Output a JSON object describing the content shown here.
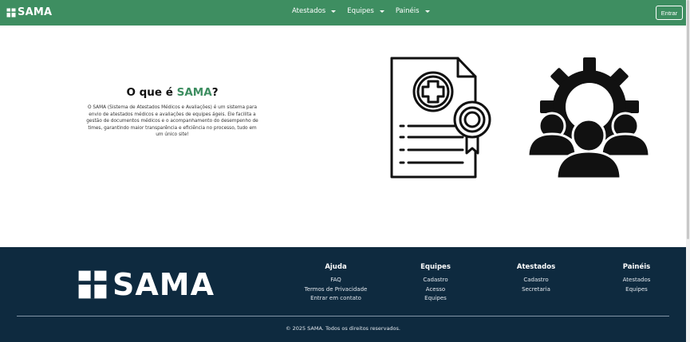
{
  "brand": {
    "name": "SAMA",
    "logo_icon": "medical-cross-logo-icon"
  },
  "nav": {
    "items": [
      {
        "label": "Atestados"
      },
      {
        "label": "Equipes"
      },
      {
        "label": "Painéis"
      }
    ],
    "login_label": "Entrar"
  },
  "about": {
    "title_prefix": "O que é ",
    "title_accent": "SAMA",
    "title_suffix": "?",
    "description": "O SAMA (Sistema de Atestados Médicos e Avaliações) é um sistema para envio de atestados médicos e avaliações de equipes ágeis. Ele facilita a gestão de documentos médicos e o acompanhamento do desempenho de times, garantindo maior transparência e eficiência no processo, tudo em um único site!"
  },
  "illustrations": {
    "certificate": "medical-certificate-icon",
    "team": "team-gear-icon"
  },
  "footer": {
    "logo_text": "SAMA",
    "columns": [
      {
        "title": "Ajuda",
        "links": [
          "FAQ",
          "Termos de Privacidade",
          "Entrar em contato"
        ]
      },
      {
        "title": "Equipes",
        "links": [
          "Cadastro",
          "Acesso",
          "Equipes"
        ]
      },
      {
        "title": "Atestados",
        "links": [
          "Cadastro",
          "Secretaria"
        ]
      },
      {
        "title": "Painéis",
        "links": [
          "Atestados",
          "Equipes"
        ]
      }
    ],
    "copyright": "© 2025 SAMA. Todos os direitos reservados."
  },
  "colors": {
    "primary": "#3e8e61",
    "footer_bg": "#0e2a3f",
    "text": "#111111"
  }
}
